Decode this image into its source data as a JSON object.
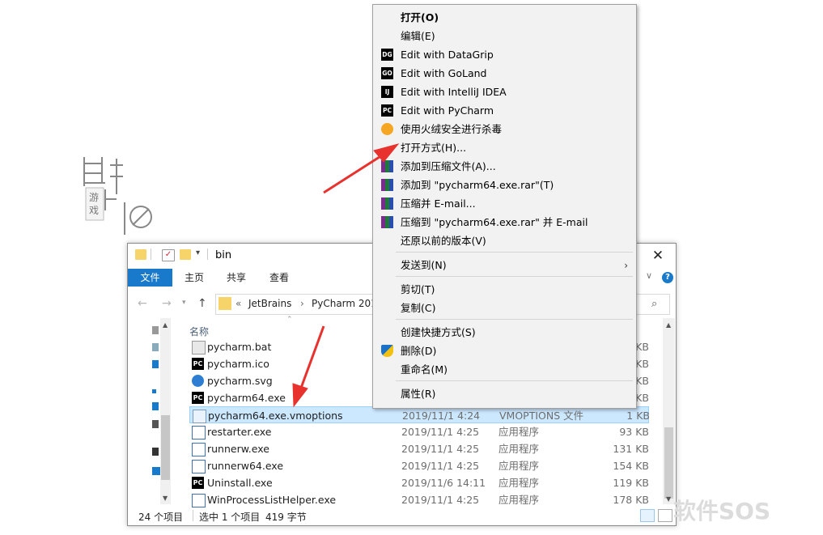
{
  "watermark": {
    "logo_text": "游戏",
    "brand": "软件SOS"
  },
  "window": {
    "title": "bin",
    "close_symbol": "✕",
    "ribbon": {
      "file": "文件",
      "tabs": [
        "主页",
        "共享",
        "查看"
      ],
      "help": "?"
    },
    "address": {
      "prefix": "«",
      "crumbs": [
        "JetBrains",
        "PyCharm 201"
      ]
    },
    "columns": {
      "name": "名称"
    },
    "files": [
      {
        "name": "pycharm.bat",
        "date": "",
        "type": "",
        "size": "KB",
        "icon": "bat-file-icon"
      },
      {
        "name": "pycharm.ico",
        "date": "",
        "type": "",
        "size": "KB",
        "icon": "pycharm-icon"
      },
      {
        "name": "pycharm.svg",
        "date": "",
        "type": "",
        "size": "KB",
        "icon": "edge-icon"
      },
      {
        "name": "pycharm64.exe",
        "date": "",
        "type": "",
        "size": "KB",
        "icon": "pycharm-icon"
      },
      {
        "name": "pycharm64.exe.vmoptions",
        "date": "2019/11/1 4:24",
        "type": "VMOPTIONS 文件",
        "size": "1 KB",
        "icon": "text-file-icon",
        "selected": true
      },
      {
        "name": "restarter.exe",
        "date": "2019/11/1 4:25",
        "type": "应用程序",
        "size": "93 KB",
        "icon": "exe-icon"
      },
      {
        "name": "runnerw.exe",
        "date": "2019/11/1 4:25",
        "type": "应用程序",
        "size": "131 KB",
        "icon": "exe-icon"
      },
      {
        "name": "runnerw64.exe",
        "date": "2019/11/1 4:25",
        "type": "应用程序",
        "size": "154 KB",
        "icon": "exe-icon"
      },
      {
        "name": "Uninstall.exe",
        "date": "2019/11/6 14:11",
        "type": "应用程序",
        "size": "119 KB",
        "icon": "uninstall-icon"
      },
      {
        "name": "WinProcessListHelper.exe",
        "date": "2019/11/1 4:25",
        "type": "应用程序",
        "size": "178 KB",
        "icon": "exe-icon"
      }
    ],
    "status": {
      "count": "24 个项目",
      "selected": "选中 1 个项目",
      "size": "419 字节"
    }
  },
  "menu": {
    "items": [
      {
        "label": "打开(O)",
        "bold": true
      },
      {
        "label": "编辑(E)"
      },
      {
        "label": "Edit with DataGrip",
        "icon": "DG"
      },
      {
        "label": "Edit with GoLand",
        "icon": "GO"
      },
      {
        "label": "Edit with IntelliJ IDEA",
        "icon": "IJ"
      },
      {
        "label": "Edit with PyCharm",
        "icon": "PC"
      },
      {
        "label": "使用火绒安全进行杀毒"
      },
      {
        "label": "打开方式(H)..."
      },
      {
        "label": "添加到压缩文件(A)..."
      },
      {
        "label": "添加到 \"pycharm64.exe.rar\"(T)"
      },
      {
        "label": "压缩并 E-mail..."
      },
      {
        "label": "压缩到 \"pycharm64.exe.rar\" 并 E-mail"
      },
      {
        "label": "还原以前的版本(V)"
      },
      {
        "label": "发送到(N)"
      },
      {
        "label": "剪切(T)"
      },
      {
        "label": "复制(C)"
      },
      {
        "label": "创建快捷方式(S)"
      },
      {
        "label": "删除(D)"
      },
      {
        "label": "重命名(M)"
      },
      {
        "label": "属性(R)"
      }
    ]
  },
  "colors": {
    "accent": "#1979ca",
    "selection": "#cce8ff",
    "annotation_arrow": "#e8322e"
  }
}
